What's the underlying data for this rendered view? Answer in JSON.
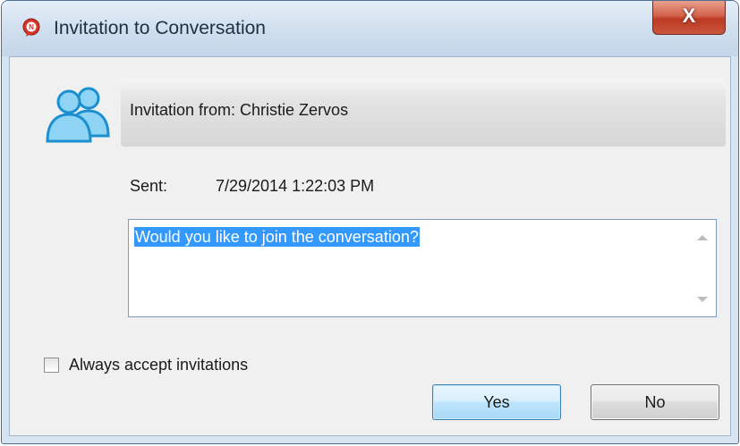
{
  "window": {
    "title": "Invitation to Conversation",
    "close_label": "X",
    "icon": "chat-app-icon"
  },
  "header": {
    "icon": "people-icon",
    "from_text": "Invitation from: Christie Zervos"
  },
  "sent": {
    "label": "Sent:",
    "value": "7/29/2014 1:22:03 PM"
  },
  "message": {
    "text": "Would you like to join the conversation?",
    "selection_color": "#3399ff"
  },
  "options": {
    "always_accept_label": "Always accept invitations",
    "always_accept_checked": false
  },
  "buttons": {
    "yes_label": "Yes",
    "no_label": "No"
  },
  "colors": {
    "frame": "#d6e3f1",
    "close_button": "#c9553d",
    "accent_icon": "#2d9fd9"
  }
}
